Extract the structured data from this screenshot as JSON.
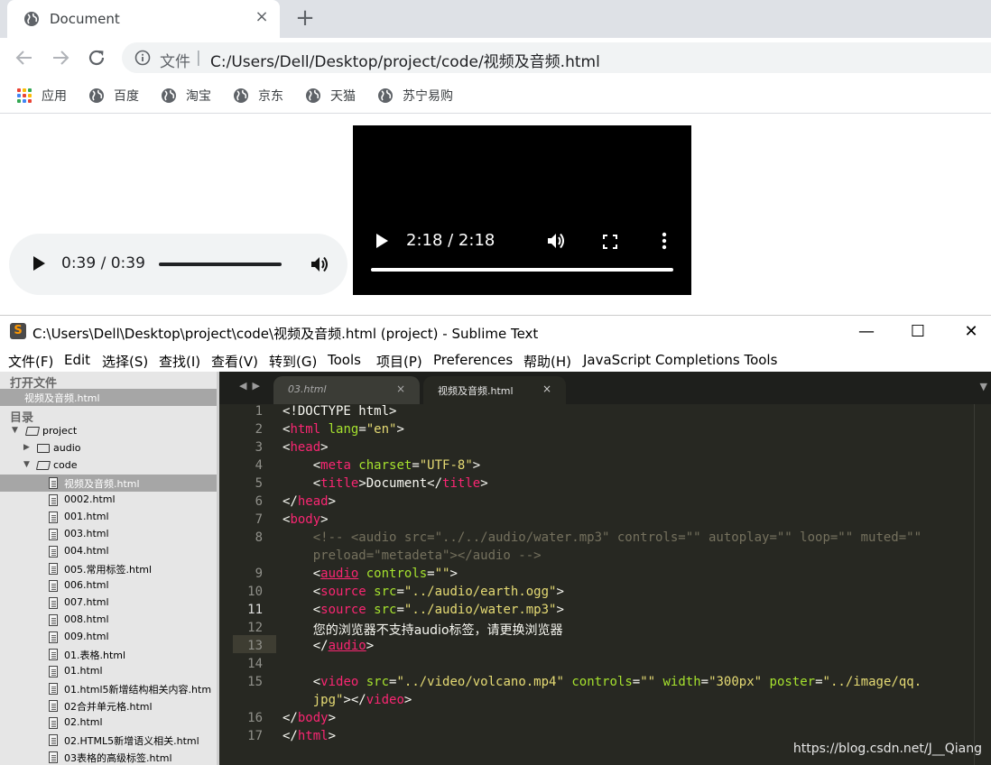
{
  "browser": {
    "tab_title": "Document",
    "tab_close": "×",
    "new_tab": "+",
    "omnibox": {
      "scheme_label": "文件",
      "separator": "|",
      "url": "C:/Users/Dell/Desktop/project/code/视频及音频.html"
    },
    "bookmarks": [
      {
        "label": "应用",
        "icon": "apps-grid-icon"
      },
      {
        "label": "百度",
        "icon": "globe-icon"
      },
      {
        "label": "淘宝",
        "icon": "globe-icon"
      },
      {
        "label": "京东",
        "icon": "globe-icon"
      },
      {
        "label": "天猫",
        "icon": "globe-icon"
      },
      {
        "label": "苏宁易购",
        "icon": "globe-icon"
      }
    ]
  },
  "page": {
    "audio": {
      "time": "0:39 / 0:39",
      "progress": 1.0
    },
    "video": {
      "time": "2:18 / 2:18",
      "progress": 1.0
    }
  },
  "sublime": {
    "window_title": "C:\\Users\\Dell\\Desktop\\project\\code\\视频及音频.html (project) - Sublime Text",
    "app_icon_letter": "S",
    "window_buttons": {
      "minimize": "—",
      "maximize": "☐",
      "close": "✕"
    },
    "menu": [
      "文件(F)",
      "Edit",
      "选择(S)",
      "查找(I)",
      "查看(V)",
      "转到(G)",
      "Tools",
      "项目(P)",
      "Preferences",
      "帮助(H)",
      "JavaScript Completions Tools"
    ],
    "sidebar": {
      "open_files_heading": "打开文件",
      "open_file": "视频及音频.html",
      "folders_heading": "目录",
      "project": "project",
      "audio_folder": "audio",
      "code_folder": "code",
      "files": [
        "视频及音频.html",
        "0002.html",
        "001.html",
        "003.html",
        "004.html",
        "005.常用标签.html",
        "006.html",
        "007.html",
        "008.html",
        "009.html",
        "01.表格.html",
        "01.html",
        "01.html5新增结构相关内容.htm",
        "02合并单元格.html",
        "02.html",
        "02.HTML5新增语义相关.html",
        "03表格的高级标签.html"
      ]
    },
    "tabs": [
      {
        "label": "03.html",
        "close": "×"
      },
      {
        "label": "视频及音频.html",
        "close": "×"
      }
    ],
    "line_numbers": [
      "1",
      "2",
      "3",
      "4",
      "5",
      "6",
      "7",
      "8",
      "9",
      "10",
      "11",
      "12",
      "13",
      "14",
      "15",
      "16",
      "17"
    ],
    "code": {
      "l1": "<!DOCTYPE html>",
      "l2_open": "<",
      "l2_tag": "html",
      "l2_attr": " lang",
      "l2_eq": "=",
      "l2_val": "\"en\"",
      "l2_close": ">",
      "l3_open": "<",
      "l3_tag": "head",
      "l3_close": ">",
      "l4_open": "    <",
      "l4_tag": "meta",
      "l4_attr": " charset",
      "l4_eq": "=",
      "l4_val": "\"UTF-8\"",
      "l4_close": ">",
      "l5_open": "    <",
      "l5_tag": "title",
      "l5_mid": ">Document</",
      "l5_tag2": "title",
      "l5_close": ">",
      "l6_open": "</",
      "l6_tag": "head",
      "l6_close": ">",
      "l7_open": "<",
      "l7_tag": "body",
      "l7_close": ">",
      "l8a": "    <!-- <audio src=\"../../audio/water.mp3\" controls=\"\" autoplay=\"\" loop=\"\" muted=\"\"",
      "l8b": "    preload=\"metadeta\"></audio -->",
      "l9_open": "    <",
      "l9_tag": "audio",
      "l9_attr": " controls",
      "l9_eq": "=",
      "l9_val": "\"\"",
      "l9_close": ">",
      "l10_open": "    <",
      "l10_tag": "source",
      "l10_attr": " src",
      "l10_eq": "=",
      "l10_val": "\"../audio/earth.ogg\"",
      "l10_close": ">",
      "l11_open": "    <",
      "l11_tag": "source",
      "l11_attr": " src",
      "l11_eq": "=",
      "l11_val": "\"../audio/water.mp3\"",
      "l11_close": ">",
      "l12_indent": "    ",
      "l12_text": "您的浏览器不支持audio标签，请更换浏览器",
      "l13_open": "    </",
      "l13_tag": "audio",
      "l13_close": ">",
      "l15_open": "    <",
      "l15_tag": "video",
      "l15_attr1": " src",
      "l15_eq1": "=",
      "l15_val1": "\"../video/volcano.mp4\"",
      "l15_attr2": " controls",
      "l15_eq2": "=",
      "l15_val2": "\"\"",
      "l15_attr3": " width",
      "l15_eq3": "=",
      "l15_val3": "\"300px\"",
      "l15_attr4": " poster",
      "l15_eq4": "=",
      "l15_val4": "\"../image/qq.",
      "l15b_indent": "    ",
      "l15b_val": "jpg\"",
      "l15b_mid": "></",
      "l15b_tag": "video",
      "l15b_close": ">",
      "l16_open": "</",
      "l16_tag": "body",
      "l16_close": ">",
      "l17_open": "</",
      "l17_tag": "html",
      "l17_close": ">"
    },
    "watermark": "https://blog.csdn.net/J__Qiang"
  },
  "colors": {
    "monokai_bg": "#272822",
    "tag": "#f92672",
    "attr": "#a6e22e",
    "string": "#e6db74",
    "comment": "#75715e"
  }
}
